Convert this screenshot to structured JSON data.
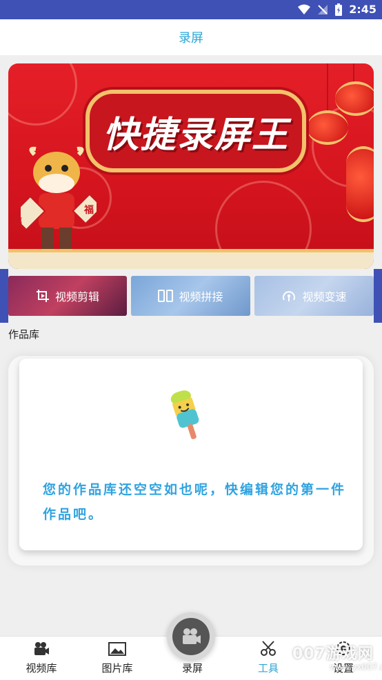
{
  "status_bar": {
    "time": "2:45"
  },
  "header": {
    "title": "录屏"
  },
  "banner": {
    "title": "快捷录屏王",
    "couplet_char": "福"
  },
  "tools": [
    {
      "label": "视频剪辑",
      "icon": "crop-icon"
    },
    {
      "label": "视频拼接",
      "icon": "split-panel-icon"
    },
    {
      "label": "视频变速",
      "icon": "speedometer-icon"
    }
  ],
  "library": {
    "section_label": "作品库",
    "empty_message": "您的作品库还空空如也呢，快编辑您的第一件作品吧。"
  },
  "nav": [
    {
      "label": "视频库",
      "icon": "video-camera-icon"
    },
    {
      "label": "图片库",
      "icon": "image-icon"
    },
    {
      "label": "录屏",
      "icon": "record-camera-icon"
    },
    {
      "label": "工具",
      "icon": "scissors-icon",
      "active": true
    },
    {
      "label": "设置",
      "icon": "gear-icon"
    }
  ],
  "watermark": {
    "text": "007游戏网",
    "sub": "www.yx007.com"
  },
  "colors": {
    "accent": "#2aa6d6",
    "status_bar": "#3f51b5",
    "banner_red": "#e51f28"
  }
}
